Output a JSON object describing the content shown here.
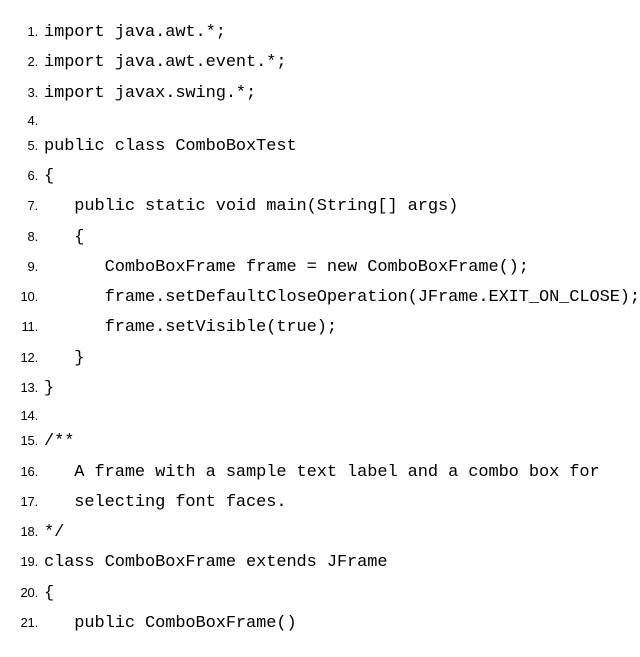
{
  "code": {
    "lines": [
      {
        "num": "1.",
        "text": "import java.awt.*;"
      },
      {
        "num": "2.",
        "text": "import java.awt.event.*;"
      },
      {
        "num": "3.",
        "text": "import javax.swing.*;"
      },
      {
        "num": "4.",
        "text": ""
      },
      {
        "num": "5.",
        "text": "public class ComboBoxTest"
      },
      {
        "num": "6.",
        "text": "{"
      },
      {
        "num": "7.",
        "text": "   public static void main(String[] args)"
      },
      {
        "num": "8.",
        "text": "   {"
      },
      {
        "num": "9.",
        "text": "      ComboBoxFrame frame = new ComboBoxFrame();"
      },
      {
        "num": "10.",
        "text": "      frame.setDefaultCloseOperation(JFrame.EXIT_ON_CLOSE);"
      },
      {
        "num": "11.",
        "text": "      frame.setVisible(true);"
      },
      {
        "num": "12.",
        "text": "   }"
      },
      {
        "num": "13.",
        "text": "}"
      },
      {
        "num": "14.",
        "text": ""
      },
      {
        "num": "15.",
        "text": "/**"
      },
      {
        "num": "16.",
        "text": "   A frame with a sample text label and a combo box for"
      },
      {
        "num": "17.",
        "text": "   selecting font faces."
      },
      {
        "num": "18.",
        "text": "*/"
      },
      {
        "num": "19.",
        "text": "class ComboBoxFrame extends JFrame"
      },
      {
        "num": "20.",
        "text": "{"
      },
      {
        "num": "21.",
        "text": "   public ComboBoxFrame()"
      }
    ]
  }
}
